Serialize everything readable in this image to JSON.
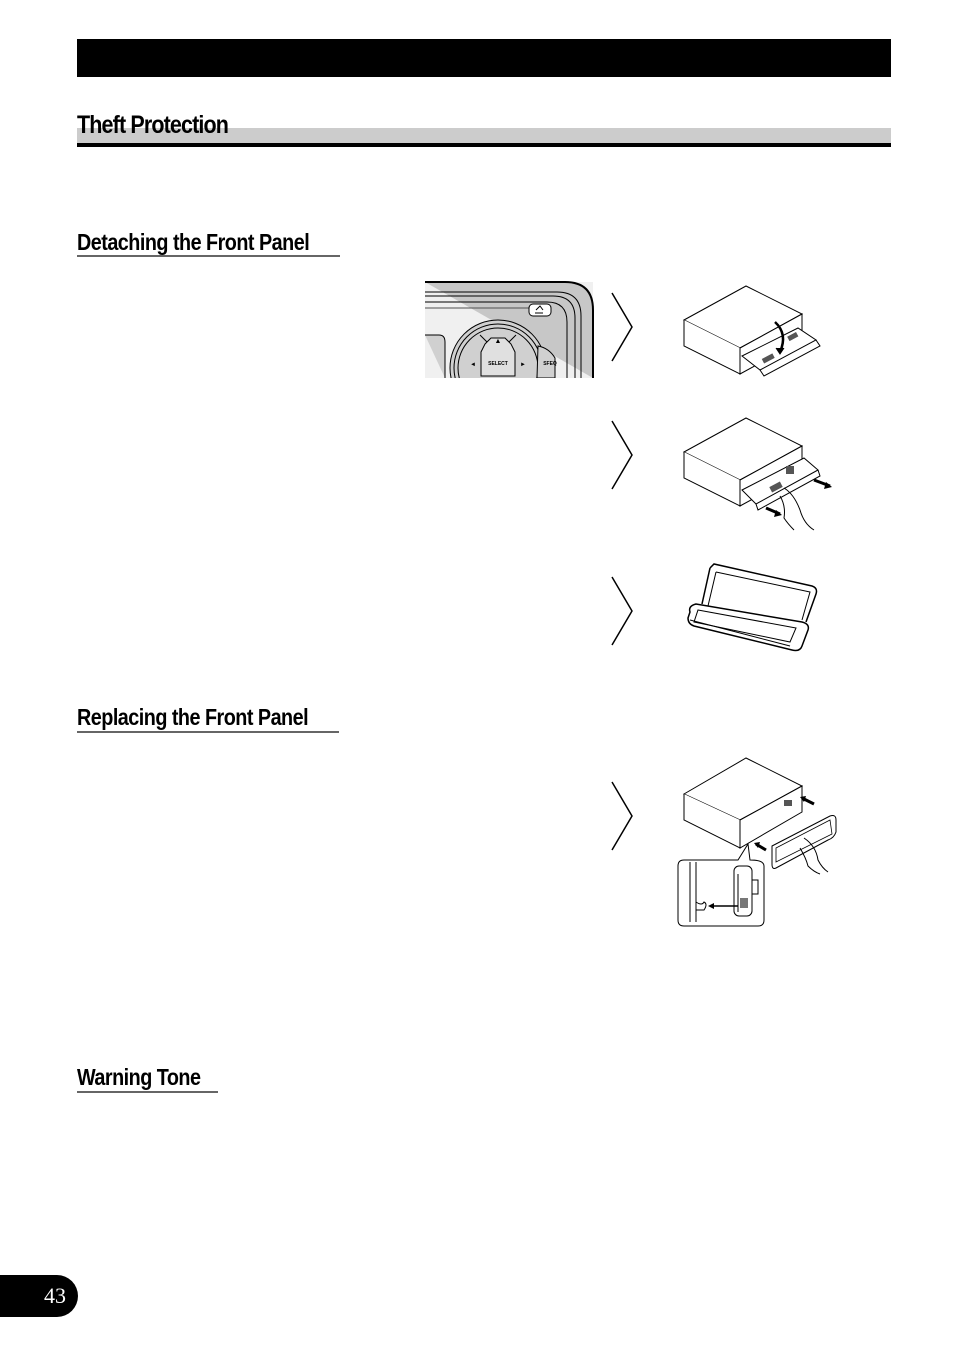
{
  "header": {
    "section_title": "Theft Protection"
  },
  "sections": [
    {
      "heading": "Detaching the Front Panel"
    },
    {
      "heading": "Replacing the Front Panel"
    },
    {
      "heading": "Warning Tone"
    }
  ],
  "panel_illustration": {
    "buttons": {
      "select_label": "SELECT",
      "sfeq_label": "SFEQ",
      "up_glyph": "▲",
      "left_glyph": "◄",
      "right_glyph": "►"
    }
  },
  "figures": [
    {
      "id": "detach-step-1",
      "depicts": "unit-with-panel-tilting-open"
    },
    {
      "id": "detach-step-2",
      "depicts": "hand-pulling-panel-out"
    },
    {
      "id": "detach-step-3",
      "depicts": "panel-in-protective-case"
    },
    {
      "id": "replace-step-1",
      "depicts": "hand-inserting-panel-with-hook-inset"
    }
  ],
  "footer": {
    "page_number": "43"
  }
}
